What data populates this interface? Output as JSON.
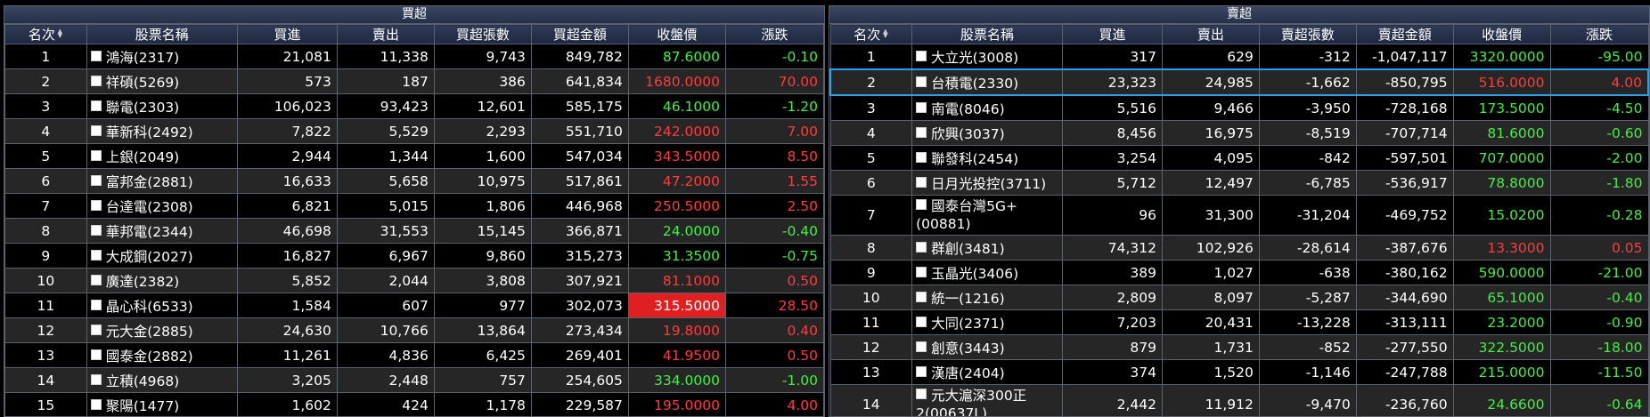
{
  "left": {
    "title": "買超",
    "headers": [
      "名次",
      "股票名稱",
      "買進",
      "賣出",
      "買超張數",
      "買超金額",
      "收盤價",
      "漲跌"
    ],
    "rows": [
      {
        "rank": "1",
        "name": "鴻海(2317)",
        "buy": "21,081",
        "sell": "11,338",
        "net": "9,743",
        "amount": "849,782",
        "close": "87.6000",
        "change": "-0.10",
        "dir": "down"
      },
      {
        "rank": "2",
        "name": "祥碩(5269)",
        "buy": "573",
        "sell": "187",
        "net": "386",
        "amount": "641,834",
        "close": "1680.0000",
        "change": "70.00",
        "dir": "up"
      },
      {
        "rank": "3",
        "name": "聯電(2303)",
        "buy": "106,023",
        "sell": "93,423",
        "net": "12,601",
        "amount": "585,175",
        "close": "46.1000",
        "change": "-1.20",
        "dir": "down"
      },
      {
        "rank": "4",
        "name": "華新科(2492)",
        "buy": "7,822",
        "sell": "5,529",
        "net": "2,293",
        "amount": "551,710",
        "close": "242.0000",
        "change": "7.00",
        "dir": "up"
      },
      {
        "rank": "5",
        "name": "上銀(2049)",
        "buy": "2,944",
        "sell": "1,344",
        "net": "1,600",
        "amount": "547,034",
        "close": "343.5000",
        "change": "8.50",
        "dir": "up"
      },
      {
        "rank": "6",
        "name": "富邦金(2881)",
        "buy": "16,633",
        "sell": "5,658",
        "net": "10,975",
        "amount": "517,861",
        "close": "47.2000",
        "change": "1.55",
        "dir": "up"
      },
      {
        "rank": "7",
        "name": "台達電(2308)",
        "buy": "6,821",
        "sell": "5,015",
        "net": "1,806",
        "amount": "446,968",
        "close": "250.5000",
        "change": "2.50",
        "dir": "up"
      },
      {
        "rank": "8",
        "name": "華邦電(2344)",
        "buy": "46,698",
        "sell": "31,553",
        "net": "15,145",
        "amount": "366,871",
        "close": "24.0000",
        "change": "-0.40",
        "dir": "down"
      },
      {
        "rank": "9",
        "name": "大成鋼(2027)",
        "buy": "16,827",
        "sell": "6,967",
        "net": "9,860",
        "amount": "315,273",
        "close": "31.3500",
        "change": "-0.75",
        "dir": "down"
      },
      {
        "rank": "10",
        "name": "廣達(2382)",
        "buy": "5,852",
        "sell": "2,044",
        "net": "3,808",
        "amount": "307,921",
        "close": "81.1000",
        "change": "0.50",
        "dir": "up"
      },
      {
        "rank": "11",
        "name": "晶心科(6533)",
        "buy": "1,584",
        "sell": "607",
        "net": "977",
        "amount": "302,073",
        "close": "315.5000",
        "change": "28.50",
        "dir": "up",
        "limit": true
      },
      {
        "rank": "12",
        "name": "元大金(2885)",
        "buy": "24,630",
        "sell": "10,766",
        "net": "13,864",
        "amount": "273,434",
        "close": "19.8000",
        "change": "0.40",
        "dir": "up"
      },
      {
        "rank": "13",
        "name": "國泰金(2882)",
        "buy": "11,261",
        "sell": "4,836",
        "net": "6,425",
        "amount": "269,401",
        "close": "41.9500",
        "change": "0.50",
        "dir": "up"
      },
      {
        "rank": "14",
        "name": "立積(4968)",
        "buy": "3,205",
        "sell": "2,448",
        "net": "757",
        "amount": "254,605",
        "close": "334.0000",
        "change": "-1.00",
        "dir": "down"
      },
      {
        "rank": "15",
        "name": "聚陽(1477)",
        "buy": "1,602",
        "sell": "424",
        "net": "1,178",
        "amount": "229,587",
        "close": "195.0000",
        "change": "4.00",
        "dir": "up"
      }
    ]
  },
  "right": {
    "title": "賣超",
    "headers": [
      "名次",
      "股票名稱",
      "買進",
      "賣出",
      "賣超張數",
      "賣超金額",
      "收盤價",
      "漲跌"
    ],
    "rows": [
      {
        "rank": "1",
        "name": "大立光(3008)",
        "buy": "317",
        "sell": "629",
        "net": "-312",
        "amount": "-1,047,117",
        "close": "3320.0000",
        "change": "-95.00",
        "dir": "down"
      },
      {
        "rank": "2",
        "name": "台積電(2330)",
        "buy": "23,323",
        "sell": "24,985",
        "net": "-1,662",
        "amount": "-850,795",
        "close": "516.0000",
        "change": "4.00",
        "dir": "up",
        "selected": true
      },
      {
        "rank": "3",
        "name": "南電(8046)",
        "buy": "5,516",
        "sell": "9,466",
        "net": "-3,950",
        "amount": "-728,168",
        "close": "173.5000",
        "change": "-4.50",
        "dir": "down"
      },
      {
        "rank": "4",
        "name": "欣興(3037)",
        "buy": "8,456",
        "sell": "16,975",
        "net": "-8,519",
        "amount": "-707,714",
        "close": "81.6000",
        "change": "-0.60",
        "dir": "down"
      },
      {
        "rank": "5",
        "name": "聯發科(2454)",
        "buy": "3,254",
        "sell": "4,095",
        "net": "-842",
        "amount": "-597,501",
        "close": "707.0000",
        "change": "-2.00",
        "dir": "down"
      },
      {
        "rank": "6",
        "name": "日月光投控(3711)",
        "buy": "5,712",
        "sell": "12,497",
        "net": "-6,785",
        "amount": "-536,917",
        "close": "78.8000",
        "change": "-1.80",
        "dir": "down"
      },
      {
        "rank": "7",
        "name": "國泰台灣5G+(00881)",
        "buy": "96",
        "sell": "31,300",
        "net": "-31,204",
        "amount": "-469,752",
        "close": "15.0200",
        "change": "-0.28",
        "dir": "down",
        "tall": true
      },
      {
        "rank": "8",
        "name": "群創(3481)",
        "buy": "74,312",
        "sell": "102,926",
        "net": "-28,614",
        "amount": "-387,676",
        "close": "13.3000",
        "change": "0.05",
        "dir": "up"
      },
      {
        "rank": "9",
        "name": "玉晶光(3406)",
        "buy": "389",
        "sell": "1,027",
        "net": "-638",
        "amount": "-380,162",
        "close": "590.0000",
        "change": "-21.00",
        "dir": "down"
      },
      {
        "rank": "10",
        "name": "統一(1216)",
        "buy": "2,809",
        "sell": "8,097",
        "net": "-5,287",
        "amount": "-344,690",
        "close": "65.1000",
        "change": "-0.40",
        "dir": "down"
      },
      {
        "rank": "11",
        "name": "大同(2371)",
        "buy": "7,203",
        "sell": "20,431",
        "net": "-13,228",
        "amount": "-313,111",
        "close": "23.2000",
        "change": "-0.90",
        "dir": "down"
      },
      {
        "rank": "12",
        "name": "創意(3443)",
        "buy": "879",
        "sell": "1,731",
        "net": "-852",
        "amount": "-277,550",
        "close": "322.5000",
        "change": "-18.00",
        "dir": "down"
      },
      {
        "rank": "13",
        "name": "漢唐(2404)",
        "buy": "374",
        "sell": "1,520",
        "net": "-1,146",
        "amount": "-247,788",
        "close": "215.0000",
        "change": "-11.50",
        "dir": "down"
      },
      {
        "rank": "14",
        "name": "元大滬深300正2(00637L)",
        "buy": "2,442",
        "sell": "11,912",
        "net": "-9,470",
        "amount": "-236,760",
        "close": "24.6600",
        "change": "-0.64",
        "dir": "down",
        "tall": true
      }
    ]
  }
}
